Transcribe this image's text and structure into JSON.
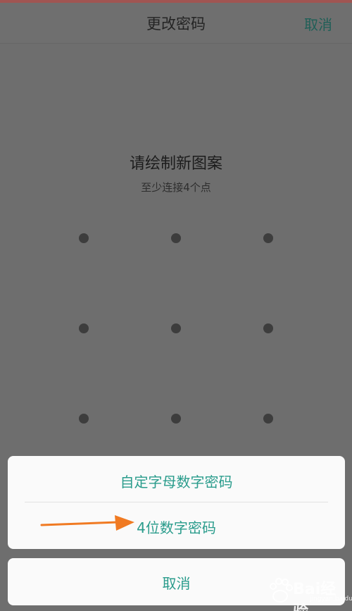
{
  "header": {
    "title": "更改密码",
    "cancel_label": "取消"
  },
  "prompt": {
    "title": "请绘制新图案",
    "subtitle": "至少连接4个点"
  },
  "pattern": {
    "rows": 3,
    "cols": 3
  },
  "sheet": {
    "options": [
      {
        "label": "自定字母数字密码"
      },
      {
        "label": "4位数字密码"
      }
    ],
    "cancel_label": "取消"
  },
  "annotation": {
    "arrow_color": "#f07a22"
  },
  "watermark": {
    "text": "Bai经验",
    "sub": "jingyan.baidu.com"
  },
  "colors": {
    "accent": "#2a9c8c",
    "overlay_bg": "#6e6e6e",
    "sheet_bg": "#fafafa"
  }
}
